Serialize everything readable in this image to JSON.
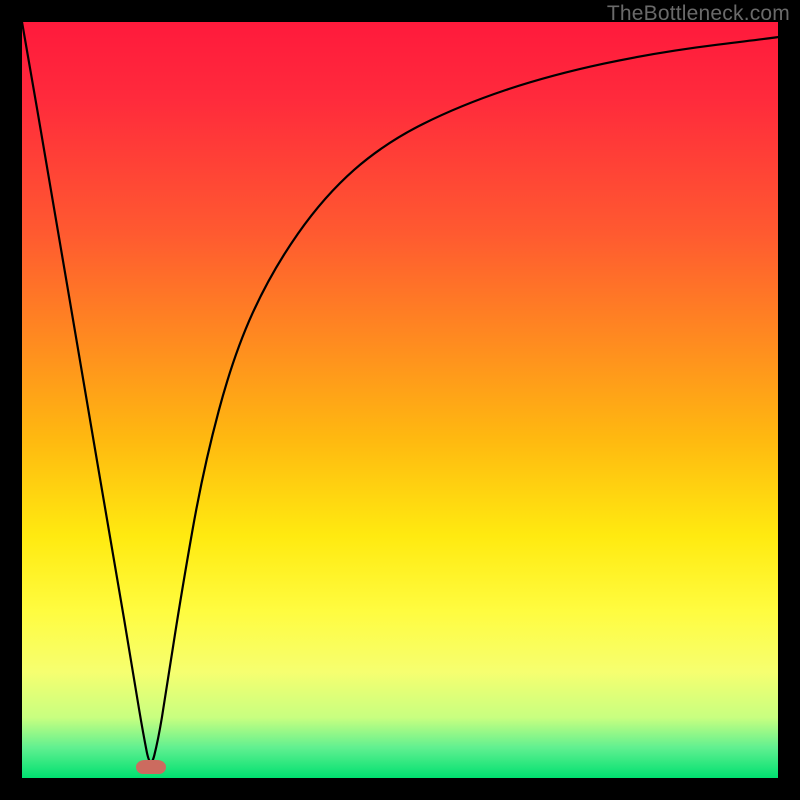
{
  "watermark": "TheBottleneck.com",
  "colors": {
    "frame": "#000000",
    "curve": "#000000",
    "bump": "#cc6b5f"
  },
  "chart_data": {
    "type": "line",
    "title": "",
    "xlabel": "",
    "ylabel": "",
    "xlim": [
      0,
      100
    ],
    "ylim": [
      0,
      100
    ],
    "gradient_stops": [
      {
        "pos": 0,
        "color": "#ff1a3c"
      },
      {
        "pos": 50,
        "color": "#ffc010"
      },
      {
        "pos": 80,
        "color": "#fffc40"
      },
      {
        "pos": 100,
        "color": "#00e070"
      }
    ],
    "minimum_x": 17,
    "series": [
      {
        "name": "curve",
        "x": [
          0,
          4,
          8,
          12,
          15,
          16,
          17,
          18,
          19,
          21,
          24,
          28,
          33,
          40,
          48,
          58,
          70,
          84,
          100
        ],
        "y": [
          100,
          77,
          53,
          30,
          12,
          6,
          1,
          5,
          11,
          24,
          41,
          56,
          67,
          77,
          84,
          89,
          93,
          96,
          98
        ]
      }
    ],
    "marker": {
      "x": 17,
      "y": 1.5
    }
  }
}
